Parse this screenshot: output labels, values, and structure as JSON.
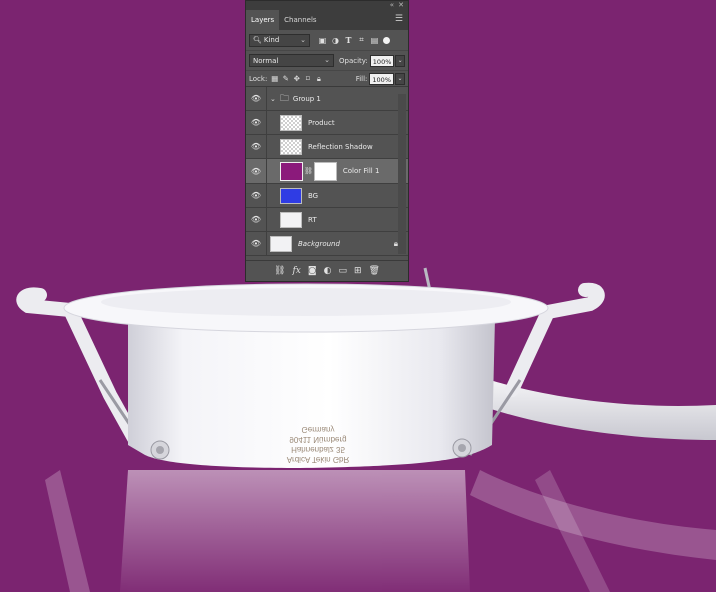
{
  "colors": {
    "background": "#7b2470",
    "panel": "#535353",
    "color_fill_swatch": "#8b1a7b",
    "bg_swatch": "#2f3ce4"
  },
  "window_controls": {
    "collapse": "«",
    "close": "✕"
  },
  "tabs": [
    {
      "label": "Layers",
      "active": true
    },
    {
      "label": "Channels",
      "active": false
    }
  ],
  "panel_menu_icon": "hamburger-icon",
  "filter": {
    "kind_label": "Kind",
    "icons": [
      "image-filter-icon",
      "adjustment-filter-icon",
      "type-filter-icon",
      "shape-filter-icon",
      "smart-object-filter-icon"
    ]
  },
  "blend": {
    "mode": "Normal",
    "opacity_label": "Opacity:",
    "opacity_value": "100%",
    "fill_label": "Fill:",
    "fill_value": "100%"
  },
  "lock": {
    "label": "Lock:",
    "icons": [
      "lock-transparent-icon",
      "lock-brush-icon",
      "lock-move-icon",
      "lock-artboard-icon",
      "lock-all-icon"
    ]
  },
  "layers": [
    {
      "name": "Group 1",
      "type": "group",
      "expanded": true
    },
    {
      "name": "Product",
      "type": "transparent-thumb"
    },
    {
      "name": "Reflection Shadow",
      "type": "transparent-thumb"
    },
    {
      "name": "Color Fill 1",
      "type": "fill-with-mask",
      "selected": true
    },
    {
      "name": "BG",
      "type": "solid-thumb"
    },
    {
      "name": "RT",
      "type": "image-thumb"
    },
    {
      "name": "Background",
      "type": "background",
      "locked": true
    }
  ],
  "footer_icons": [
    "link-layers-icon",
    "fx-icon",
    "add-mask-icon",
    "new-adjustment-icon",
    "new-group-icon",
    "new-layer-icon",
    "trash-icon"
  ],
  "product_label_lines": [
    "ArdicA Tekin GbR",
    "Hahnenbalz 35",
    "90411 Nürnberg",
    "Germany"
  ]
}
